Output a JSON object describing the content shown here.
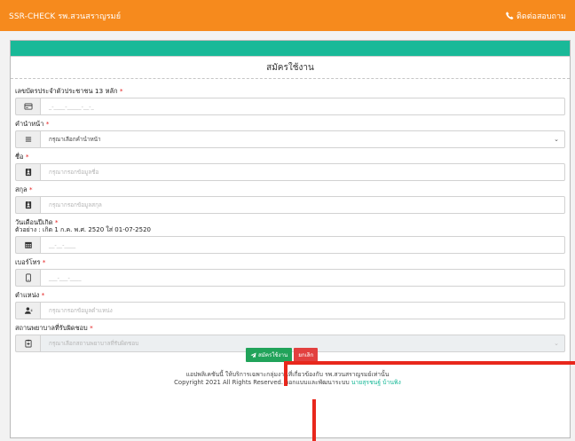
{
  "navbar": {
    "brand": "SSR-CHECK รพ.สวนสราญรมย์",
    "contact": "ติดต่อสอบถาม"
  },
  "card": {
    "title": "สมัครใช้งาน"
  },
  "form": {
    "id_card": {
      "label": "เลขบัตรประจำตัวประชาชน 13 หลัก",
      "placeholder": "_-____-_____-__-_",
      "icon": "id-card-icon"
    },
    "prefix": {
      "label": "คำนำหน้า",
      "placeholder": "กรุณาเลือกคำนำหน้า",
      "icon": "list-icon"
    },
    "first_name": {
      "label": "ชื่อ",
      "placeholder": "กรุณากรอกข้อมูลชื่อ",
      "icon": "id-badge-icon"
    },
    "last_name": {
      "label": "สกุล",
      "placeholder": "กรุณากรอกข้อมูลสกุล",
      "icon": "id-badge-icon"
    },
    "birth_date": {
      "label": "วันเดือนปีเกิด",
      "example": "ตัวอย่าง : เกิด 1 ก.ค. พ.ศ. 2520 ใส่ 01-07-2520",
      "placeholder": "__-__-____",
      "icon": "calendar-icon"
    },
    "phone": {
      "label": "เบอร์โทร",
      "placeholder": "___-___-____",
      "icon": "mobile-icon"
    },
    "position": {
      "label": "ตำแหน่ง",
      "placeholder": "กรุณากรอกข้อมูลตำแหน่ง",
      "icon": "user-tie-icon"
    },
    "hospital": {
      "label": "สถานพยาบาลที่รับผิดชอบ",
      "placeholder": "กรุณาเลือกสถานพยาบาลที่รับผิดชอบ",
      "icon": "clipboard-icon"
    },
    "required_mark": "*"
  },
  "buttons": {
    "submit": "สมัครใช้งาน",
    "cancel": "ยกเลิก"
  },
  "footer": {
    "line1": "แอปพลิเคชันนี้ ให้บริการเฉพาะกลุ่มงานที่เกี่ยวข้องกับ รพ.สวนสราญรมย์เท่านั้น",
    "line2_prefix": "Copyright 2021 All Rights Reserved. ออกแบบและพัฒนาระบบ",
    "line2_link": "นายสุรชนฐ์ บ้านพิง"
  },
  "colors": {
    "navbar": "#f68a1d",
    "accent": "#19b998",
    "submit": "#21a35a",
    "cancel": "#e2403f",
    "annotation": "#e8271c"
  }
}
